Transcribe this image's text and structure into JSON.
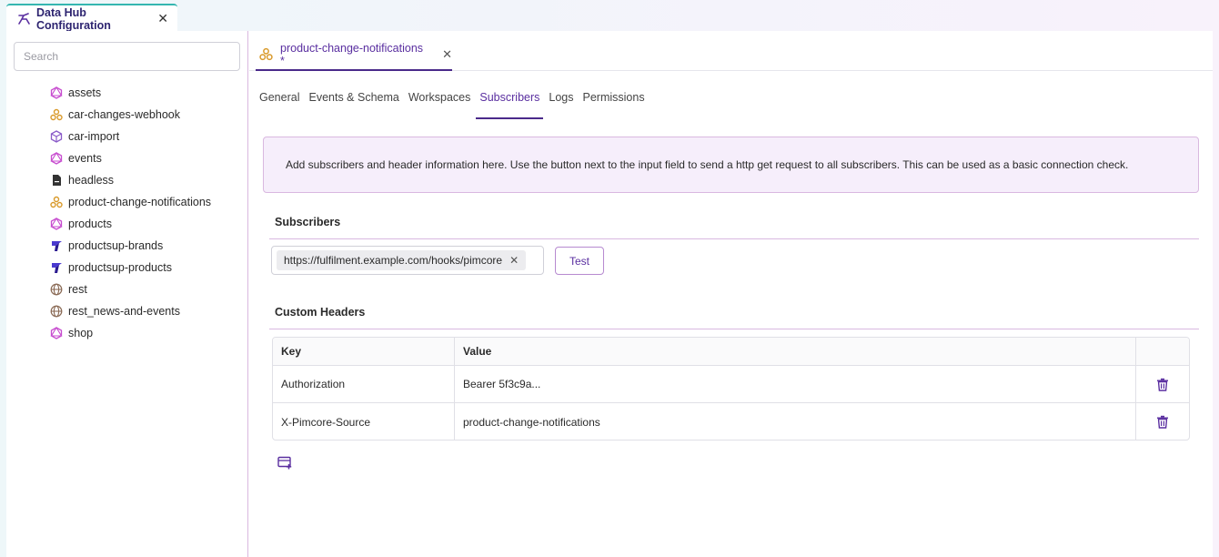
{
  "window": {
    "title": "Data Hub Configuration"
  },
  "sidebar": {
    "search_placeholder": "Search",
    "items": [
      {
        "label": "assets",
        "icon": "graphql-icon"
      },
      {
        "label": "car-changes-webhook",
        "icon": "webhook-icon"
      },
      {
        "label": "car-import",
        "icon": "cube-icon"
      },
      {
        "label": "events",
        "icon": "graphql-icon"
      },
      {
        "label": "headless",
        "icon": "file-icon"
      },
      {
        "label": "product-change-notifications",
        "icon": "webhook-icon"
      },
      {
        "label": "products",
        "icon": "graphql-icon"
      },
      {
        "label": "productsup-brands",
        "icon": "productsup-icon"
      },
      {
        "label": "productsup-products",
        "icon": "productsup-icon"
      },
      {
        "label": "rest",
        "icon": "globe-icon"
      },
      {
        "label": "rest_news-and-events",
        "icon": "globe-icon"
      },
      {
        "label": "shop",
        "icon": "graphql-icon"
      }
    ]
  },
  "doc_tab": {
    "label": "product-change-notifications *"
  },
  "subtabs": [
    "General",
    "Events & Schema",
    "Workspaces",
    "Subscribers",
    "Logs",
    "Permissions"
  ],
  "active_subtab": "Subscribers",
  "notice": "Add subscribers and header information here. Use the button next to the input field to send a http get request to all subscribers. This can be used as a basic connection check.",
  "subscribers": {
    "title": "Subscribers",
    "urls": [
      "https://fulfilment.example.com/hooks/pimcore"
    ],
    "test_label": "Test"
  },
  "headers": {
    "title": "Custom Headers",
    "columns": {
      "key": "Key",
      "value": "Value"
    },
    "rows": [
      {
        "key": "Authorization",
        "value": "Bearer 5f3c9a..."
      },
      {
        "key": "X-Pimcore-Source",
        "value": "product-change-notifications"
      }
    ]
  },
  "colors": {
    "accent": "#5a2fa0",
    "graphql": "#c74ccf",
    "webhook": "#d99a2b",
    "tab_top": "#35b6b0"
  }
}
